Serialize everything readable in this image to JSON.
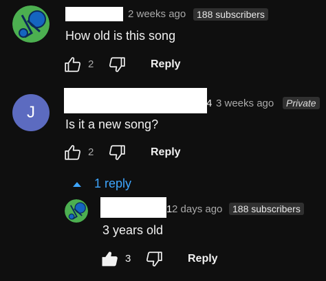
{
  "comments": [
    {
      "age": "2 weeks ago",
      "badge": "188 subscribers",
      "text": "How old is this song",
      "likes": "2",
      "reply_label": "Reply"
    },
    {
      "avatar_letter": "J",
      "name_fragment": "4",
      "age": "3 weeks ago",
      "badge": "Private",
      "text": "Is it a new song?",
      "likes": "2",
      "reply_label": "Reply",
      "replies_toggle": "1 reply",
      "replies": [
        {
          "name_fragment": "1",
          "age": "2 days ago",
          "badge": "188 subscribers",
          "text": "3 years old",
          "likes": "3",
          "reply_label": "Reply"
        }
      ]
    }
  ],
  "colors": {
    "background": "#0f0f0f",
    "link_blue": "#3ea6ff",
    "avatar_purple": "#5c6bc0",
    "avatar_green": "#4caf50"
  }
}
